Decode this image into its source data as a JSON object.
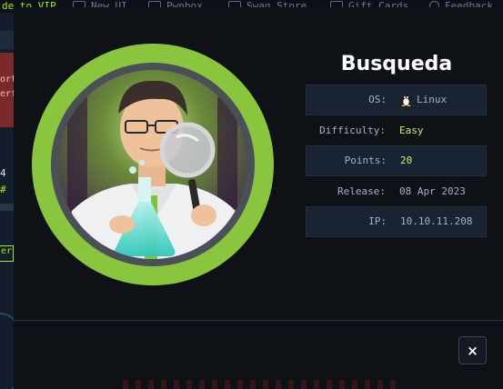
{
  "background": {
    "topbar": {
      "upgrade_text": "de to VIP",
      "nav": [
        {
          "label": "New UI",
          "icon": "monitor-icon"
        },
        {
          "label": "Pwnbox",
          "icon": "pwnbox-icon"
        },
        {
          "label": "Swag Store",
          "icon": "store-icon"
        },
        {
          "label": "Gift Cards",
          "icon": "gift-icon"
        },
        {
          "label": "Feedback",
          "icon": "feedback-icon"
        }
      ]
    },
    "left": {
      "alert_lines": [
        "ort",
        "erf"
      ],
      "number": "4",
      "hash": "#",
      "button_label": "er"
    }
  },
  "modal": {
    "machine_name": "Busqueda",
    "avatar": "scientist-with-flask-and-magnifier-avatar",
    "rows": [
      {
        "label": "OS:",
        "value": "Linux",
        "icon": "linux-tux-icon"
      },
      {
        "label": "Difficulty:",
        "value": "Easy"
      },
      {
        "label": "Points:",
        "value": "20"
      },
      {
        "label": "Release:",
        "value": "08 Apr 2023"
      },
      {
        "label": "IP:",
        "value": "10.10.11.208"
      }
    ],
    "close_label": "×",
    "colors": {
      "accent_green": "#9fef00",
      "ring_green": "#8ac53e",
      "value_green": "#c5f467"
    }
  }
}
